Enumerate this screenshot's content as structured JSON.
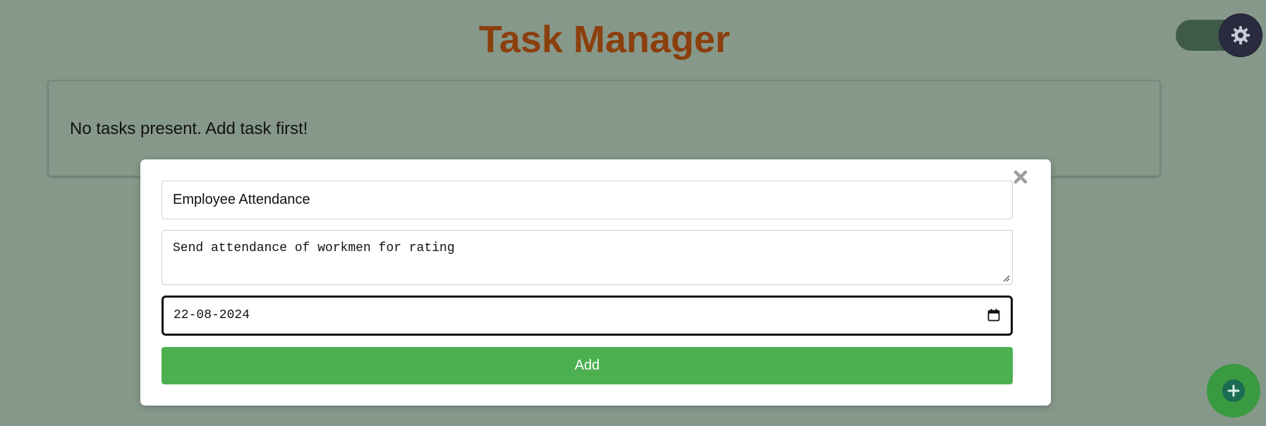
{
  "header": {
    "title": "Task Manager"
  },
  "tasks": {
    "empty_message": "No tasks present. Add task first!"
  },
  "add_task_modal": {
    "title_value": "Employee Attendance",
    "description_value": "Send attendance of workmen for rating",
    "date_value": "22-08-2024",
    "add_button_label": "Add"
  },
  "icons": {
    "settings": "gear-icon",
    "close": "close-icon",
    "calendar": "calendar-icon",
    "add": "plus-icon"
  },
  "colors": {
    "background": "#86988a",
    "title": "#8b3f0d",
    "add_button": "#4caf50",
    "fab": "#3a9a42",
    "toggle_track": "#3f5a48",
    "toggle_knob": "#2a2b3f"
  }
}
